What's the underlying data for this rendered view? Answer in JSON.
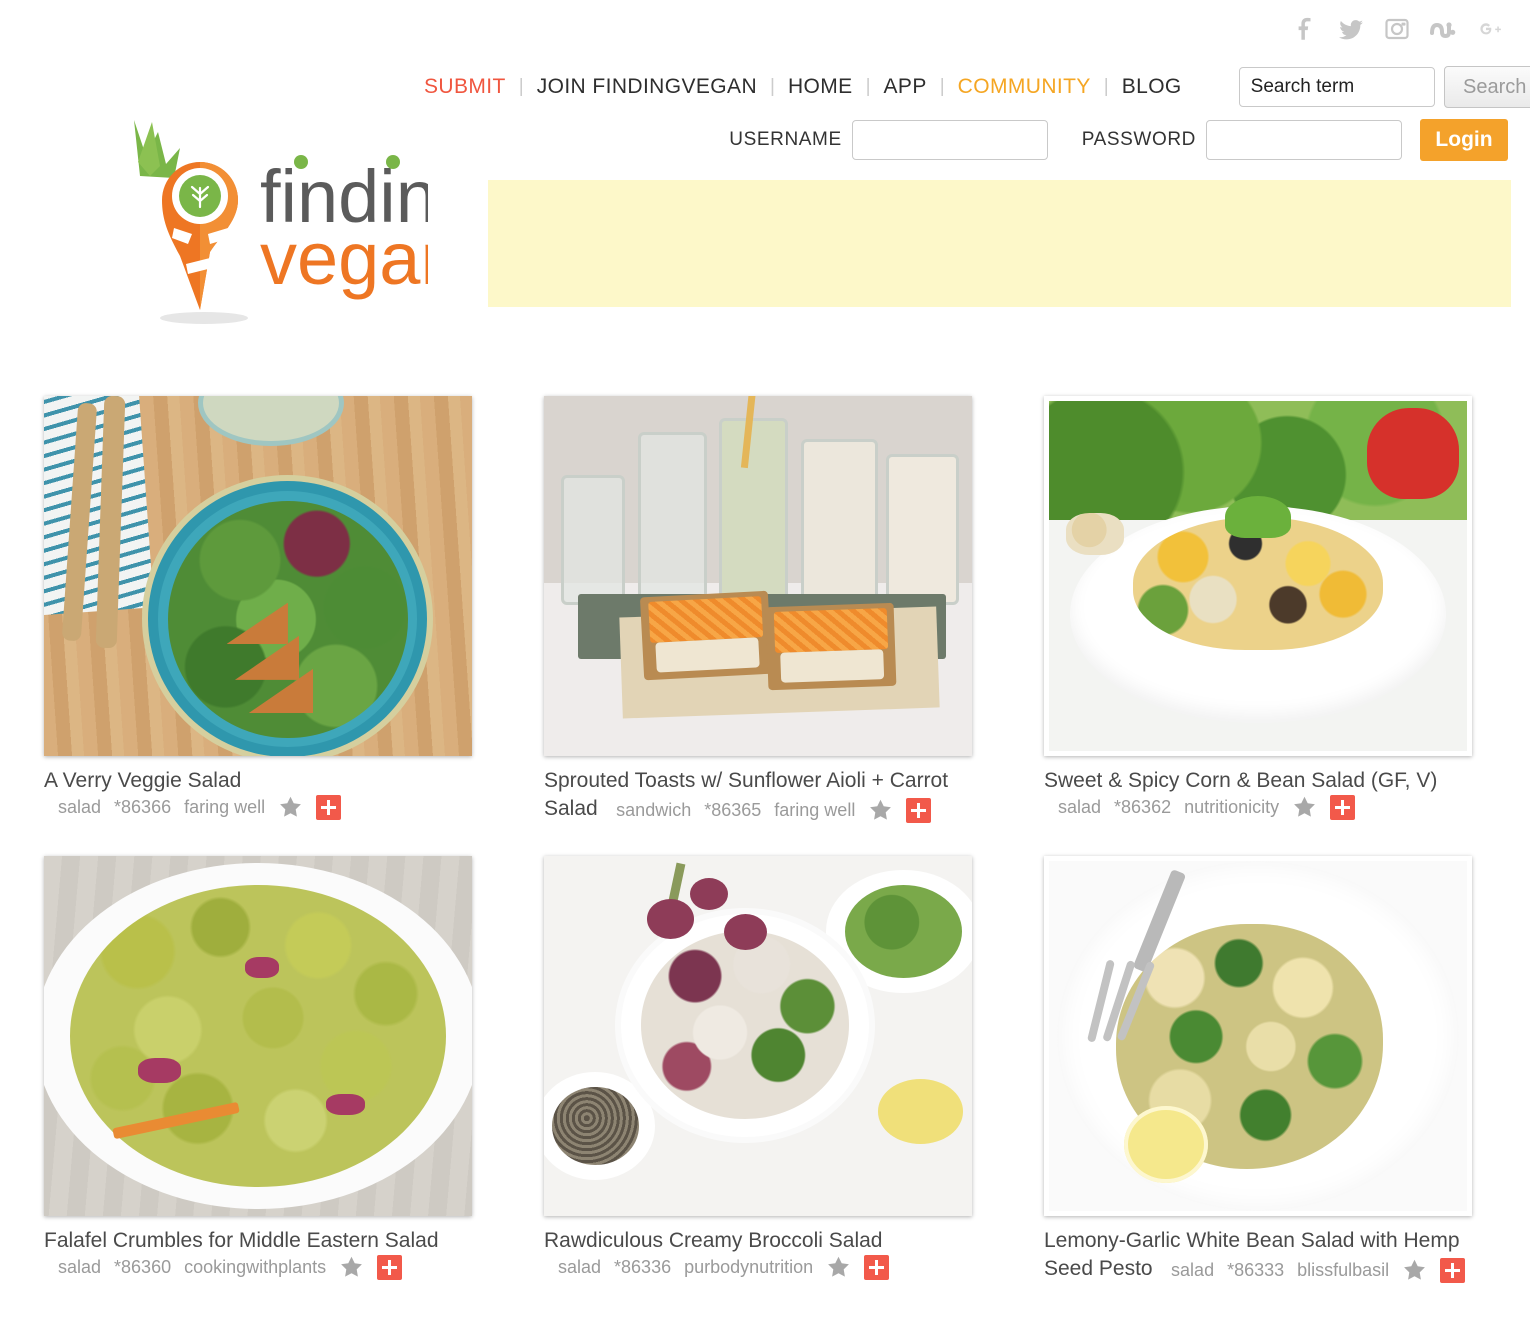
{
  "site": {
    "logo_word_1": "finding",
    "logo_word_2": "vegan",
    "brand_orange": "#ee7623",
    "brand_green": "#7ab648",
    "accent_red": "#f0563f",
    "accent_orange": "#f5a623",
    "plus_color": "#f2594a",
    "ad_banner_color": "#fdf8c9"
  },
  "social": [
    {
      "name": "facebook-icon",
      "label": "Facebook"
    },
    {
      "name": "twitter-icon",
      "label": "Twitter"
    },
    {
      "name": "instagram-icon",
      "label": "Instagram"
    },
    {
      "name": "stumbleupon-icon",
      "label": "StumbleUpon"
    },
    {
      "name": "googleplus-icon",
      "label": "Google Plus"
    }
  ],
  "nav": {
    "items": [
      {
        "label": "SUBMIT",
        "style": "submit"
      },
      {
        "label": "JOIN FINDINGVEGAN",
        "style": "normal"
      },
      {
        "label": "HOME",
        "style": "normal"
      },
      {
        "label": "APP",
        "style": "normal"
      },
      {
        "label": "COMMUNITY",
        "style": "community"
      },
      {
        "label": "BLOG",
        "style": "normal"
      }
    ],
    "separator": "|"
  },
  "search": {
    "value": "Search term",
    "placeholder": "Search term",
    "button_label": "Search"
  },
  "login": {
    "username_label": "USERNAME",
    "username_value": "",
    "password_label": "PASSWORD",
    "password_value": "",
    "button_label": "Login"
  },
  "cards": [
    {
      "title": "A Verry Veggie Salad",
      "category": "salad",
      "id": "*86366",
      "author": "faring well",
      "photo": "p1",
      "padded": false,
      "star": "star-icon",
      "add": "add-to-collection-button"
    },
    {
      "title": "Sprouted Toasts w/ Sunflower Aioli + Carrot Salad",
      "category": "sandwich",
      "id": "*86365",
      "author": "faring well",
      "photo": "p2",
      "padded": false,
      "star": "star-icon",
      "add": "add-to-collection-button"
    },
    {
      "title": "Sweet & Spicy Corn & Bean Salad (GF, V)",
      "category": "salad",
      "id": "*86362",
      "author": "nutritionicity",
      "photo": "p3",
      "padded": true,
      "star": "star-icon",
      "add": "add-to-collection-button"
    },
    {
      "title": "Falafel Crumbles for Middle Eastern Salad",
      "category": "salad",
      "id": "*86360",
      "author": "cookingwithplants",
      "photo": "p4",
      "padded": false,
      "star": "star-icon",
      "add": "add-to-collection-button"
    },
    {
      "title": "Rawdiculous Creamy Broccoli Salad",
      "category": "salad",
      "id": "*86336",
      "author": "purbodynutrition",
      "photo": "p5",
      "padded": false,
      "star": "star-icon",
      "add": "add-to-collection-button"
    },
    {
      "title": "Lemony-Garlic White Bean Salad with Hemp Seed Pesto",
      "category": "salad",
      "id": "*86333",
      "author": "blissfulbasil",
      "photo": "p6",
      "padded": true,
      "star": "star-icon",
      "add": "add-to-collection-button"
    }
  ]
}
